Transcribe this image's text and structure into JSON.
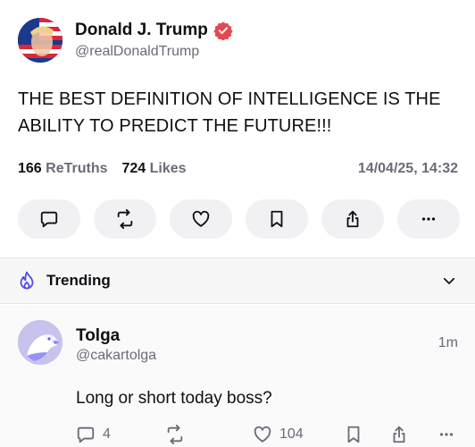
{
  "post": {
    "author_name": "Donald J. Trump",
    "author_handle": "@realDonaldTrump",
    "text": "THE BEST DEFINITION OF INTELLIGENCE IS THE ABILITY TO PREDICT THE FUTURE!!!",
    "retruths_count": "166",
    "retruths_label": "ReTruths",
    "likes_count": "724",
    "likes_label": "Likes",
    "timestamp": "14/04/25, 14:32"
  },
  "actions": [
    {
      "icon": "comment-icon"
    },
    {
      "icon": "retruth-icon"
    },
    {
      "icon": "heart-icon"
    },
    {
      "icon": "bookmark-icon"
    },
    {
      "icon": "share-icon"
    },
    {
      "icon": "more-icon"
    }
  ],
  "trending": {
    "label": "Trending",
    "icon": "flame-icon"
  },
  "reply": {
    "author_name": "Tolga",
    "author_handle": "@cakartolga",
    "time": "1m",
    "text": "Long or short today boss?",
    "comment_count": "4",
    "like_count": "104"
  },
  "colors": {
    "verified": "#e5484d",
    "accent": "#5448ee",
    "muted": "#6b6b78",
    "button_bg": "#f1f1f3"
  }
}
